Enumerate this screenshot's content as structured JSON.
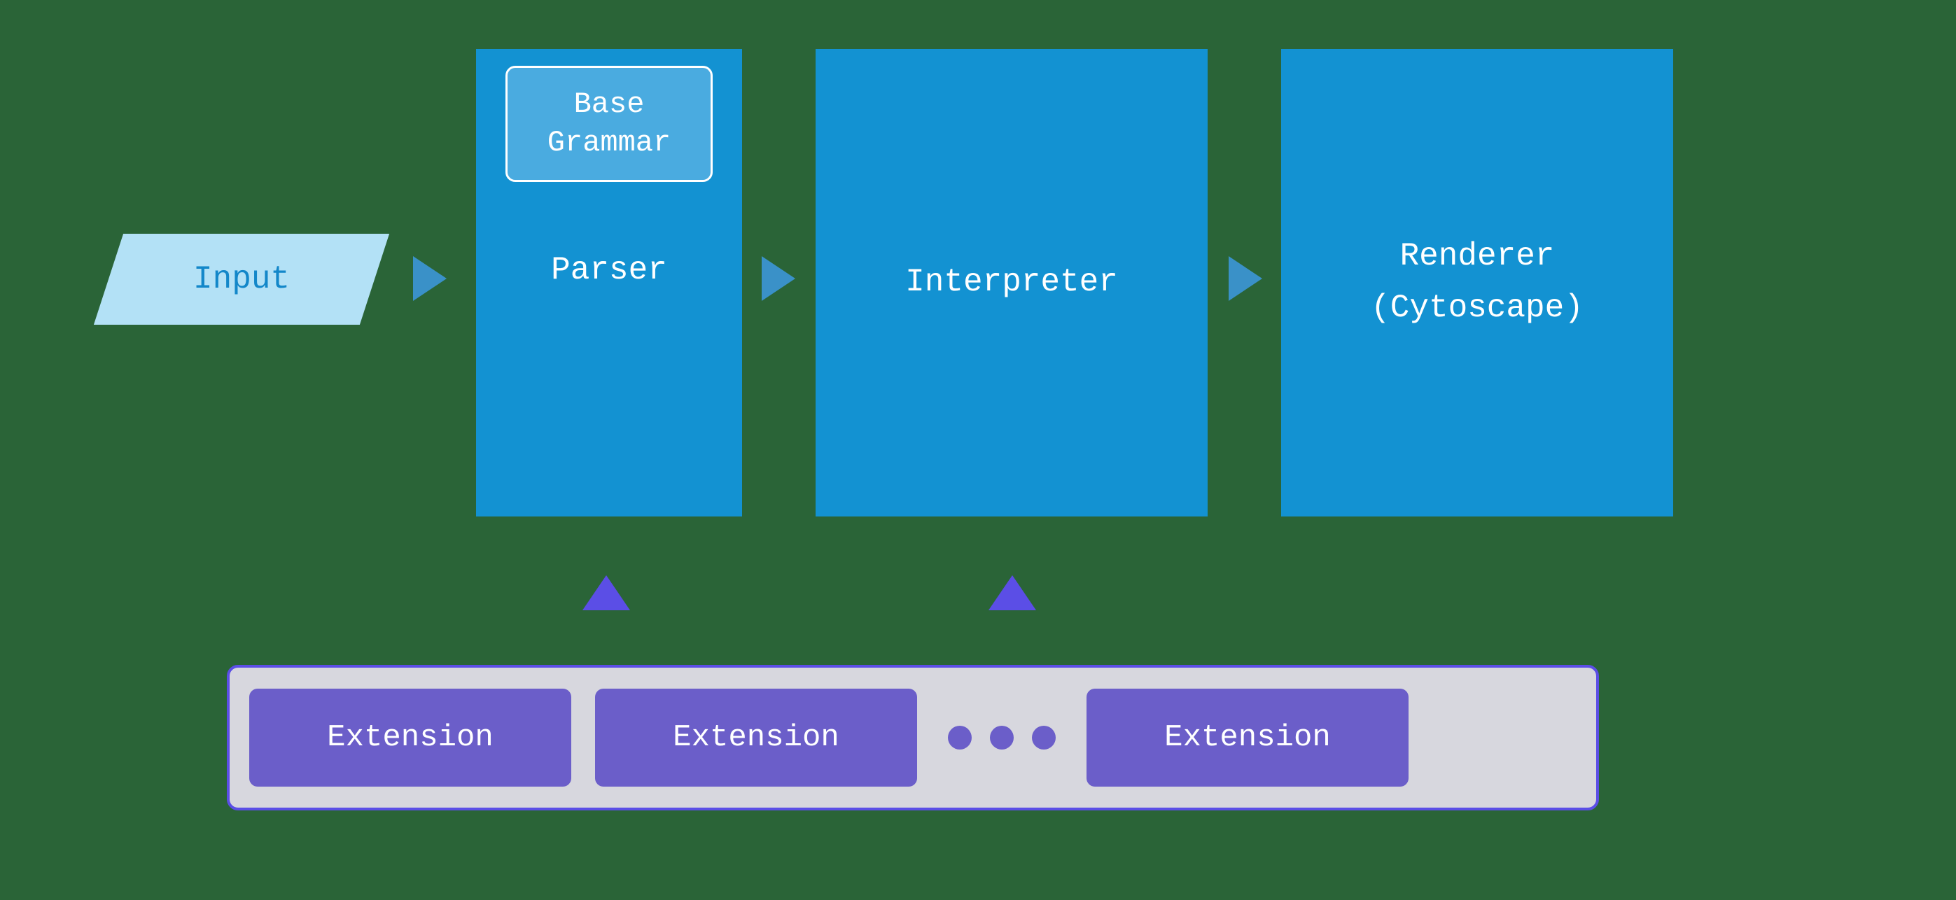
{
  "pipeline": {
    "input": {
      "label": "Input"
    },
    "parser": {
      "label": "Parser",
      "inner": {
        "label_line1": "Base",
        "label_line2": "Grammar"
      }
    },
    "interpreter": {
      "label": "Interpreter"
    },
    "renderer": {
      "label_line1": "Renderer",
      "label_line2": "(Cytoscape)"
    }
  },
  "extensions": {
    "items": [
      {
        "label": "Extension"
      },
      {
        "label": "Extension"
      },
      {
        "label": "Extension"
      }
    ],
    "ellipsis": "…"
  },
  "colors": {
    "background_green": "#2a6437",
    "process_blue": "#1392d2",
    "input_light_blue": "#b3e1f6",
    "input_text_blue": "#1387c9",
    "subbox_blue": "#4aabe0",
    "arrow_blue": "#3a91c8",
    "violet": "#5b4ee6",
    "ext_fill": "#6b5ec9",
    "ext_container_bg": "#d7d7de",
    "white": "#ffffff"
  }
}
